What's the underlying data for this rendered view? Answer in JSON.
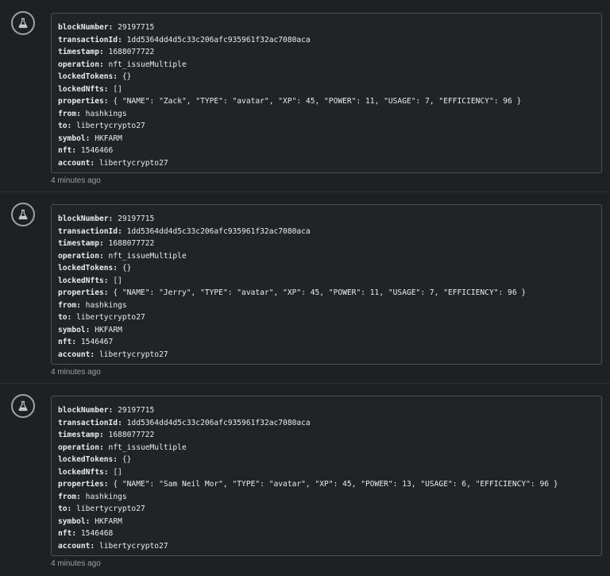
{
  "icon": "flask-icon",
  "entries": [
    {
      "blockNumber": "29197715",
      "transactionId": "1dd5364dd4d5c33c206afc935961f32ac7080aca",
      "timestamp": "1688077722",
      "operation": "nft_issueMultiple",
      "lockedTokens": "{}",
      "lockedNfts": "[]",
      "properties": "{ \"NAME\": \"Zack\", \"TYPE\": \"avatar\", \"XP\": 45, \"POWER\": 11, \"USAGE\": 7, \"EFFICIENCY\": 96 }",
      "from": "hashkings",
      "to": "libertycrypto27",
      "symbol": "HKFARM",
      "nft": "1546466",
      "account": "libertycrypto27",
      "time": "4 minutes ago"
    },
    {
      "blockNumber": "29197715",
      "transactionId": "1dd5364dd4d5c33c206afc935961f32ac7080aca",
      "timestamp": "1688077722",
      "operation": "nft_issueMultiple",
      "lockedTokens": "{}",
      "lockedNfts": "[]",
      "properties": "{ \"NAME\": \"Jerry\", \"TYPE\": \"avatar\", \"XP\": 45, \"POWER\": 11, \"USAGE\": 7, \"EFFICIENCY\": 96 }",
      "from": "hashkings",
      "to": "libertycrypto27",
      "symbol": "HKFARM",
      "nft": "1546467",
      "account": "libertycrypto27",
      "time": "4 minutes ago"
    },
    {
      "blockNumber": "29197715",
      "transactionId": "1dd5364dd4d5c33c206afc935961f32ac7080aca",
      "timestamp": "1688077722",
      "operation": "nft_issueMultiple",
      "lockedTokens": "{}",
      "lockedNfts": "[]",
      "properties": "{ \"NAME\": \"Sam Neil Mor\", \"TYPE\": \"avatar\", \"XP\": 45, \"POWER\": 13, \"USAGE\": 6, \"EFFICIENCY\": 96 }",
      "from": "hashkings",
      "to": "libertycrypto27",
      "symbol": "HKFARM",
      "nft": "1546468",
      "account": "libertycrypto27",
      "time": "4 minutes ago"
    }
  ]
}
